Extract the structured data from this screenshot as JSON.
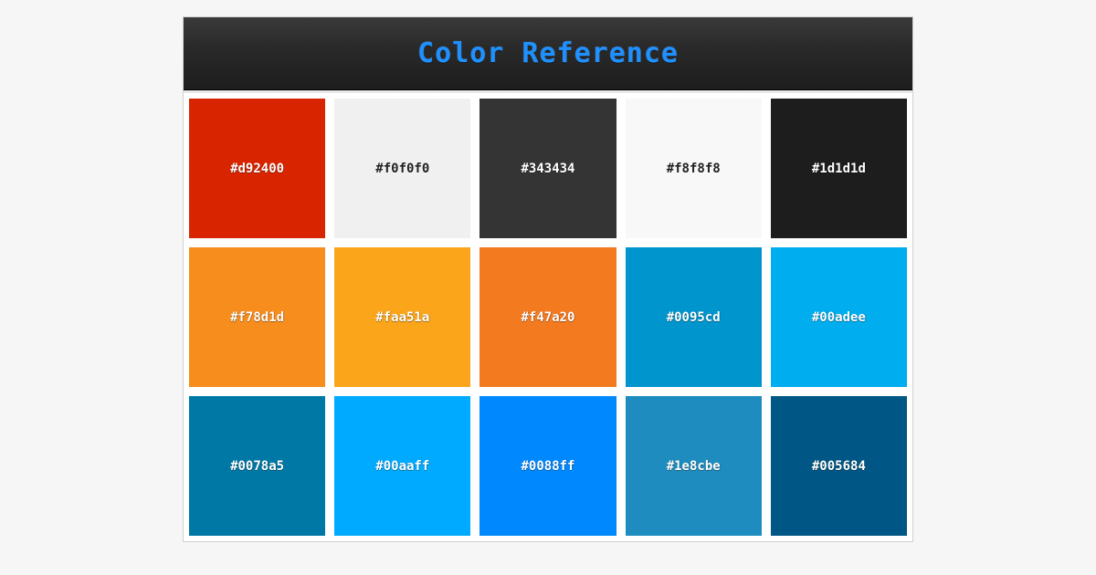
{
  "header": {
    "title": "Color Reference"
  },
  "swatches": [
    {
      "hex": "#d92400",
      "text_light": true
    },
    {
      "hex": "#f0f0f0",
      "text_light": false
    },
    {
      "hex": "#343434",
      "text_light": true
    },
    {
      "hex": "#f8f8f8",
      "text_light": false
    },
    {
      "hex": "#1d1d1d",
      "text_light": true
    },
    {
      "hex": "#f78d1d",
      "text_light": true
    },
    {
      "hex": "#faa51a",
      "text_light": true
    },
    {
      "hex": "#f47a20",
      "text_light": true
    },
    {
      "hex": "#0095cd",
      "text_light": true
    },
    {
      "hex": "#00adee",
      "text_light": true
    },
    {
      "hex": "#0078a5",
      "text_light": true
    },
    {
      "hex": "#00aaff",
      "text_light": true
    },
    {
      "hex": "#0088ff",
      "text_light": true
    },
    {
      "hex": "#1e8cbe",
      "text_light": true
    },
    {
      "hex": "#005684",
      "text_light": true
    }
  ]
}
